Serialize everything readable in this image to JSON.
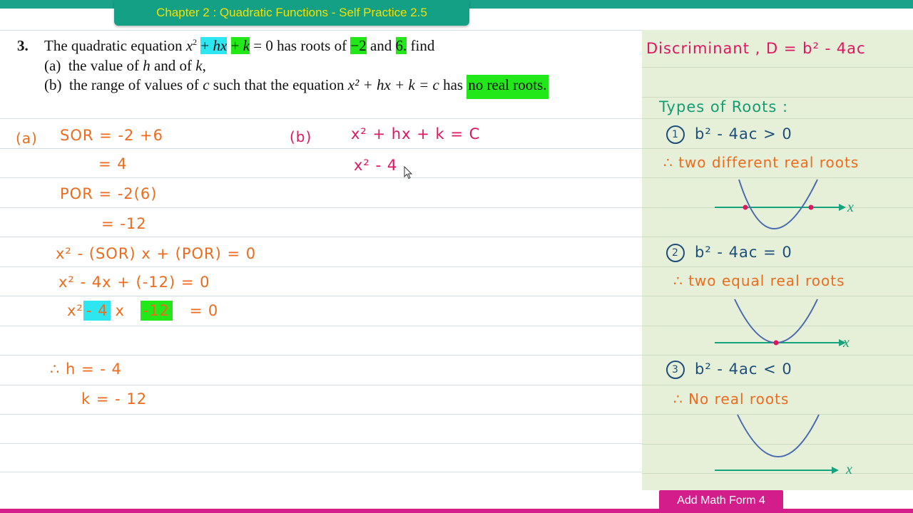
{
  "header": {
    "chapter_title": "Chapter 2 : Quadratic Functions - Self Practice 2.5"
  },
  "footer": {
    "label": "Add Math Form 4"
  },
  "question": {
    "number": "3.",
    "line1": {
      "prefix": "The quadratic equation ",
      "x2": "x",
      "plus1": "+",
      "hx": "hx",
      "plus2": "+",
      "k": "k",
      "suffix": " = 0 has roots of ",
      "root1": "−2",
      "and": " and ",
      "root2": "6.",
      "find": " find"
    },
    "part_a": {
      "label": "(a)",
      "text_pre": "the value of ",
      "h": "h",
      "and_of": " and of ",
      "k": "k",
      "end": ","
    },
    "part_b": {
      "label": "(b)",
      "text_pre": "the range of values of ",
      "c": "c",
      "text_mid": " such that the equation ",
      "eq": "x² + hx + k = c",
      "has": " has ",
      "no_real": "no real roots."
    }
  },
  "working_a": {
    "label": "(a)",
    "sor": "SOR = -2 +6",
    "sor_val": "= 4",
    "por": "POR = -2(6)",
    "por_val": "= -12",
    "eq1": "x² - (SOR) x + (POR) = 0",
    "eq2": "x² - 4x + (-12) = 0",
    "eq3_x2": "x²",
    "eq3_m4": "- 4",
    "eq3_x": "x",
    "eq3_m12": "-12",
    "eq3_end": "= 0",
    "h_ans": "∴  h = - 4",
    "k_ans": "k = - 12"
  },
  "working_b": {
    "label": "(b)",
    "eq1": "x² + hx + k = C",
    "eq2": "x² - 4"
  },
  "notes": {
    "discriminant": "Discriminant , D = b² - 4ac",
    "types_title": "Types of Roots :",
    "case1_num": "1",
    "case1_cond": "b² - 4ac > 0",
    "case1_text": "∴ two different real roots",
    "case2_num": "2",
    "case2_cond": "b² - 4ac = 0",
    "case2_text": "∴ two equal real roots",
    "case3_num": "3",
    "case3_cond": "b² - 4ac < 0",
    "case3_text": "∴   No real roots",
    "axis_label": "x"
  },
  "colors": {
    "accent_teal": "#14a085",
    "title_yellow": "#f2e000",
    "footer_magenta": "#d21d8b",
    "highlight_cyan": "#2ee6f0",
    "highlight_green": "#22e81a",
    "ink_orange": "#ee6b1e",
    "ink_pink": "#e01560",
    "ink_blue": "#1e4e7a",
    "ink_teal": "#139e72",
    "panel_green": "#e6f0d8"
  }
}
